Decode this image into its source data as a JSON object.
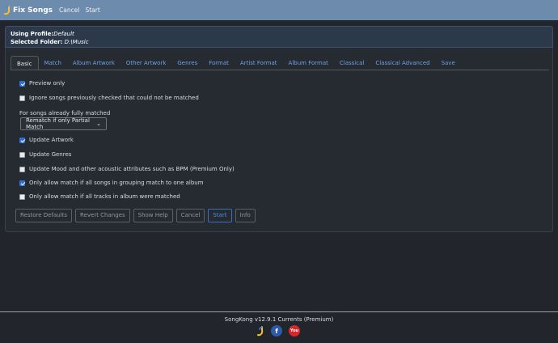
{
  "header": {
    "title": "Fix Songs",
    "nav": [
      "Cancel",
      "Start"
    ]
  },
  "profile": {
    "profile_label": "Using Profile:",
    "profile_value": "Default",
    "folder_label": "Selected Folder:",
    "folder_value": "D:\\Music"
  },
  "tabs": [
    "Basic",
    "Match",
    "Album Artwork",
    "Other Artwork",
    "Genres",
    "Format",
    "Artist Format",
    "Album Format",
    "Classical",
    "Classical Advanced",
    "Save"
  ],
  "active_tab": "Basic",
  "options": {
    "preview_only": {
      "label": "Preview only",
      "checked": true
    },
    "ignore_previous": {
      "label": "Ignore songs previously checked that could not be matched",
      "checked": false
    },
    "update_artwork": {
      "label": "Update Artwork",
      "checked": true
    },
    "update_genres": {
      "label": "Update Genres",
      "checked": false
    },
    "update_mood": {
      "label": "Update Mood and other acoustic attributes such as BPM (Premium Only)",
      "checked": false
    },
    "only_grouping": {
      "label": "Only allow match if all songs in grouping match to one album",
      "checked": true
    },
    "only_all_tracks": {
      "label": "Only allow match if all tracks in album were matched",
      "checked": false
    }
  },
  "already_matched": {
    "label": "For songs already fully matched",
    "selected": "Rematch if only Partial Match"
  },
  "buttons": [
    "Restore Defaults",
    "Revert Changes",
    "Show Help",
    "Cancel",
    "Start",
    "Info"
  ],
  "footer": {
    "version": "SongKong v12.9.1 Currents (Premium)",
    "icons": [
      "songkong-icon",
      "facebook-icon",
      "youtube-icon"
    ],
    "youtube_text": "You"
  },
  "colors": {
    "header_bg": "#6d8bad",
    "page_bg": "#22252b",
    "accent": "#2d6fd6",
    "link": "#6fa1e6"
  }
}
